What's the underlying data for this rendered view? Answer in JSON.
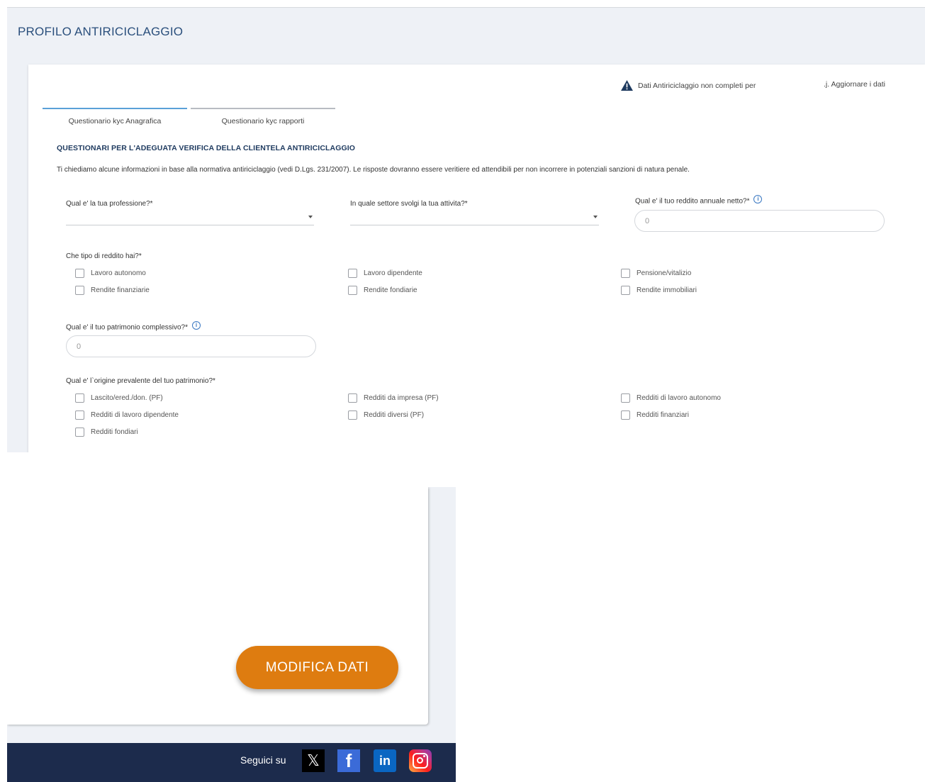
{
  "page": {
    "title": "PROFILO ANTIRICICLAGGIO"
  },
  "warning": {
    "text": "Dati Antiriciclaggio non completi per",
    "suffix": ".j. Aggiornare i dati",
    "icon": "warning-triangle-icon",
    "color": "#1e3a5f"
  },
  "tabs": [
    {
      "label": "Questionario kyc Anagrafica",
      "active": true
    },
    {
      "label": "Questionario kyc rapporti",
      "active": false
    }
  ],
  "section": {
    "title": "QUESTIONARI PER L'ADEGUATA VERIFICA DELLA CLIENTELA ANTIRICICLAGGIO",
    "intro": "Ti chiediamo alcune informazioni in base alla normativa antiriciclaggio (vedi D.Lgs. 231/2007). Le risposte dovranno essere veritiere ed attendibili per non incorrere in potenziali sanzioni di natura penale."
  },
  "fields": {
    "profession": {
      "label": "Qual e' la tua professione?*",
      "value": ""
    },
    "sector": {
      "label": "In quale settore svolgi la tua attivita?*",
      "value": ""
    },
    "income": {
      "label": "Qual e' il tuo reddito annuale netto?*",
      "placeholder": "0"
    },
    "income_type": {
      "label": "Che tipo di reddito hai?*",
      "options": [
        "Lavoro autonomo",
        "Lavoro dipendente",
        "Pensione/vitalizio",
        "Rendite finanziarie",
        "Rendite fondiarie",
        "Rendite immobiliari"
      ]
    },
    "assets": {
      "label": "Qual e' il tuo patrimonio complessivo?*",
      "placeholder": "0"
    },
    "assets_origin": {
      "label": "Qual e' l`origine prevalente del tuo patrimonio?*",
      "options": [
        "Lascito/ered./don. (PF)",
        "Redditi da impresa (PF)",
        "Redditi di lavoro autonomo",
        "Redditi di lavoro dipendente",
        "Redditi diversi (PF)",
        "Redditi finanziari",
        "Redditi fondiari"
      ]
    }
  },
  "actions": {
    "modify_label": "MODIFICA DATI",
    "modify_color": "#de7c10"
  },
  "footer": {
    "follow_label": "Seguici su",
    "socials": [
      {
        "name": "x-icon",
        "glyph": "𝕏"
      },
      {
        "name": "facebook-icon",
        "glyph": "f"
      },
      {
        "name": "linkedin-icon",
        "glyph": "in"
      },
      {
        "name": "instagram-icon",
        "glyph": ""
      }
    ],
    "background": "#1c2b4c"
  }
}
